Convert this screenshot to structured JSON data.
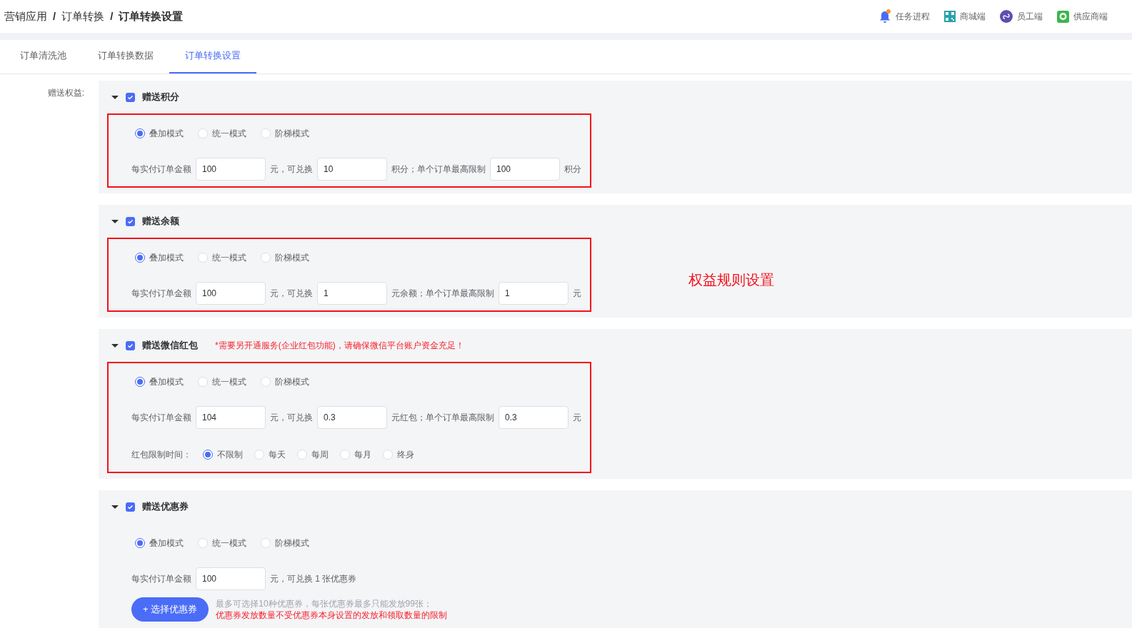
{
  "breadcrumb": [
    "营销应用",
    "订单转换",
    "订单转换设置"
  ],
  "breadcrumb_separator": "/",
  "header_links": [
    {
      "kind": "bell",
      "label": "任务进程",
      "badge": true
    },
    {
      "kind": "qr",
      "label": "商城端"
    },
    {
      "kind": "link",
      "label": "员工端"
    },
    {
      "kind": "chat",
      "label": "供应商端"
    }
  ],
  "tabs": [
    {
      "label": "订单清洗池",
      "selected": false
    },
    {
      "label": "订单转换数据",
      "selected": false
    },
    {
      "label": "订单转换设置",
      "selected": true
    }
  ],
  "form_label": "赠送权益:",
  "annotation": "权益规则设置",
  "sections": [
    {
      "title": "赠送积分",
      "checked": true,
      "expanded": true,
      "highlighted": true,
      "modes": [
        {
          "label": "叠加模式",
          "selected": true
        },
        {
          "label": "统一模式",
          "selected": false
        },
        {
          "label": "阶梯模式",
          "selected": false
        }
      ],
      "rule": [
        {
          "kind": "text",
          "text": "每实付订单金额"
        },
        {
          "kind": "input",
          "value": "100"
        },
        {
          "kind": "text",
          "text": "元，可兑换"
        },
        {
          "kind": "input",
          "value": "10"
        },
        {
          "kind": "text",
          "text": "积分；单个订单最高限制"
        },
        {
          "kind": "input",
          "value": "100"
        },
        {
          "kind": "text",
          "text": "积分"
        }
      ]
    },
    {
      "title": "赠送余额",
      "checked": true,
      "expanded": true,
      "highlighted": true,
      "modes": [
        {
          "label": "叠加模式",
          "selected": true
        },
        {
          "label": "统一模式",
          "selected": false
        },
        {
          "label": "阶梯模式",
          "selected": false
        }
      ],
      "rule": [
        {
          "kind": "text",
          "text": "每实付订单金额"
        },
        {
          "kind": "input",
          "value": "100"
        },
        {
          "kind": "text",
          "text": "元，可兑换"
        },
        {
          "kind": "input",
          "value": "1"
        },
        {
          "kind": "text",
          "text": "元余额；单个订单最高限制"
        },
        {
          "kind": "input",
          "value": "1"
        },
        {
          "kind": "text",
          "text": "元"
        }
      ]
    },
    {
      "title": "赠送微信红包",
      "checked": true,
      "expanded": true,
      "highlighted": true,
      "note": "*需要另开通服务(企业红包功能)，请确保微信平台账户资金充足！",
      "modes": [
        {
          "label": "叠加模式",
          "selected": true
        },
        {
          "label": "统一模式",
          "selected": false
        },
        {
          "label": "阶梯模式",
          "selected": false
        }
      ],
      "rule": [
        {
          "kind": "text",
          "text": "每实付订单金额"
        },
        {
          "kind": "input",
          "value": "104"
        },
        {
          "kind": "text",
          "text": "元，可兑换"
        },
        {
          "kind": "input",
          "value": "0.3"
        },
        {
          "kind": "text",
          "text": "元红包；单个订单最高限制"
        },
        {
          "kind": "input",
          "value": "0.3"
        },
        {
          "kind": "text",
          "text": "元"
        }
      ],
      "limit": {
        "label": "红包限制时间：",
        "options": [
          {
            "label": "不限制",
            "selected": true
          },
          {
            "label": "每天",
            "selected": false
          },
          {
            "label": "每周",
            "selected": false
          },
          {
            "label": "每月",
            "selected": false
          },
          {
            "label": "终身",
            "selected": false
          }
        ]
      }
    },
    {
      "title": "赠送优惠券",
      "checked": true,
      "expanded": true,
      "highlighted": false,
      "modes": [
        {
          "label": "叠加模式",
          "selected": true
        },
        {
          "label": "统一模式",
          "selected": false
        },
        {
          "label": "阶梯模式",
          "selected": false
        }
      ],
      "rule": [
        {
          "kind": "text",
          "text": "每实付订单金额"
        },
        {
          "kind": "input",
          "value": "100"
        },
        {
          "kind": "text",
          "text": "元，可兑换 1 张优惠券"
        }
      ],
      "button": "+ 选择优惠券",
      "hints": [
        {
          "text": "最多可选择10种优惠券，每张优惠券最多只能发放99张；",
          "warning": false
        },
        {
          "text": "优惠券发放数量不受优惠券本身设置的发放和领取数量的限制",
          "warning": true
        }
      ]
    }
  ]
}
